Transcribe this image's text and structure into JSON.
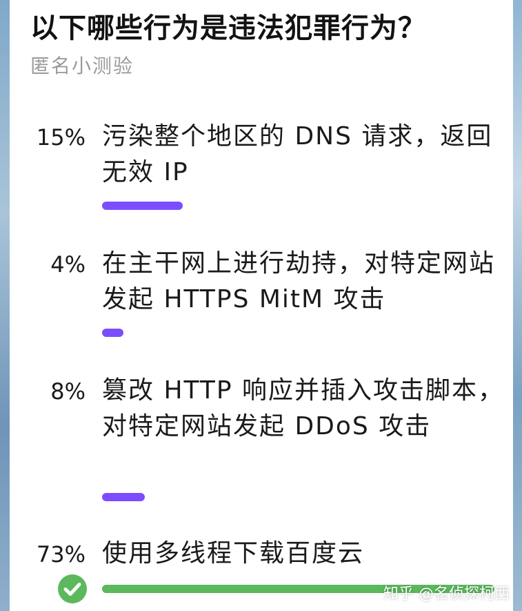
{
  "question": {
    "title": "以下哪些行为是违法犯罪行为？",
    "subtitle": "匿名小测验"
  },
  "options": [
    {
      "percent_label": "15%",
      "text": "污染整个地区的 DNS 请求，返回无效 IP",
      "share": 0.15,
      "bar_color": "#7c4dff",
      "correct": false
    },
    {
      "percent_label": "4%",
      "text": "在主干网上进行劫持，对特定网站发起 HTTPS MitM 攻击",
      "share": 0.04,
      "bar_color": "#7c4dff",
      "correct": false
    },
    {
      "percent_label": "8%",
      "text": "篡改 HTTP 响应并插入攻击脚本，对特定网站发起 DDoS 攻击",
      "share": 0.08,
      "bar_color": "#7c4dff",
      "correct": false
    },
    {
      "percent_label": "73%",
      "text": "使用多线程下载百度云",
      "share": 0.73,
      "bar_color": "#5cb85c",
      "correct": true
    }
  ],
  "icons": {
    "correct_marker": "check-circle-icon"
  },
  "watermark": "知乎 @名侦探柯西"
}
